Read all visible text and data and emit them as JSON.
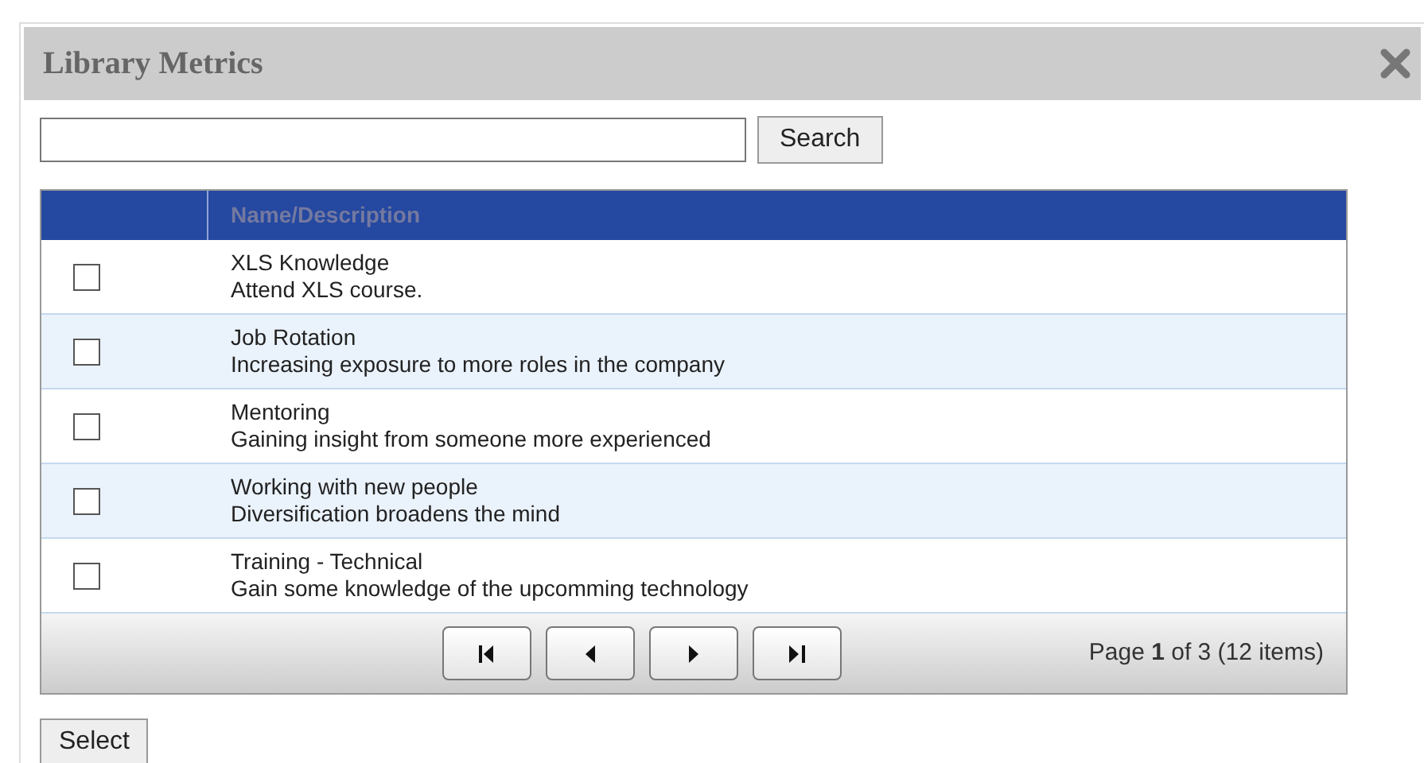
{
  "dialog": {
    "title": "Library Metrics"
  },
  "search": {
    "button": "Search"
  },
  "table": {
    "columns": [
      "Name/Description"
    ],
    "rows": [
      {
        "name": "XLS Knowledge",
        "description": "Attend XLS course.",
        "checked": false
      },
      {
        "name": "Job Rotation",
        "description": "Increasing exposure to more roles in the company",
        "checked": false
      },
      {
        "name": "Mentoring",
        "description": "Gaining insight from someone more experienced",
        "checked": false
      },
      {
        "name": "Working with new people",
        "description": "Diversification broadens the mind",
        "checked": false
      },
      {
        "name": "Training - Technical",
        "description": "Gain some knowledge of the upcomming technology",
        "checked": false
      }
    ]
  },
  "pager": {
    "buttons": [
      {
        "kind": "first"
      },
      {
        "kind": "prev"
      },
      {
        "kind": "next"
      },
      {
        "kind": "last"
      }
    ],
    "info": "Page **1** of 3 (12 items)"
  },
  "select_button": "Select"
}
